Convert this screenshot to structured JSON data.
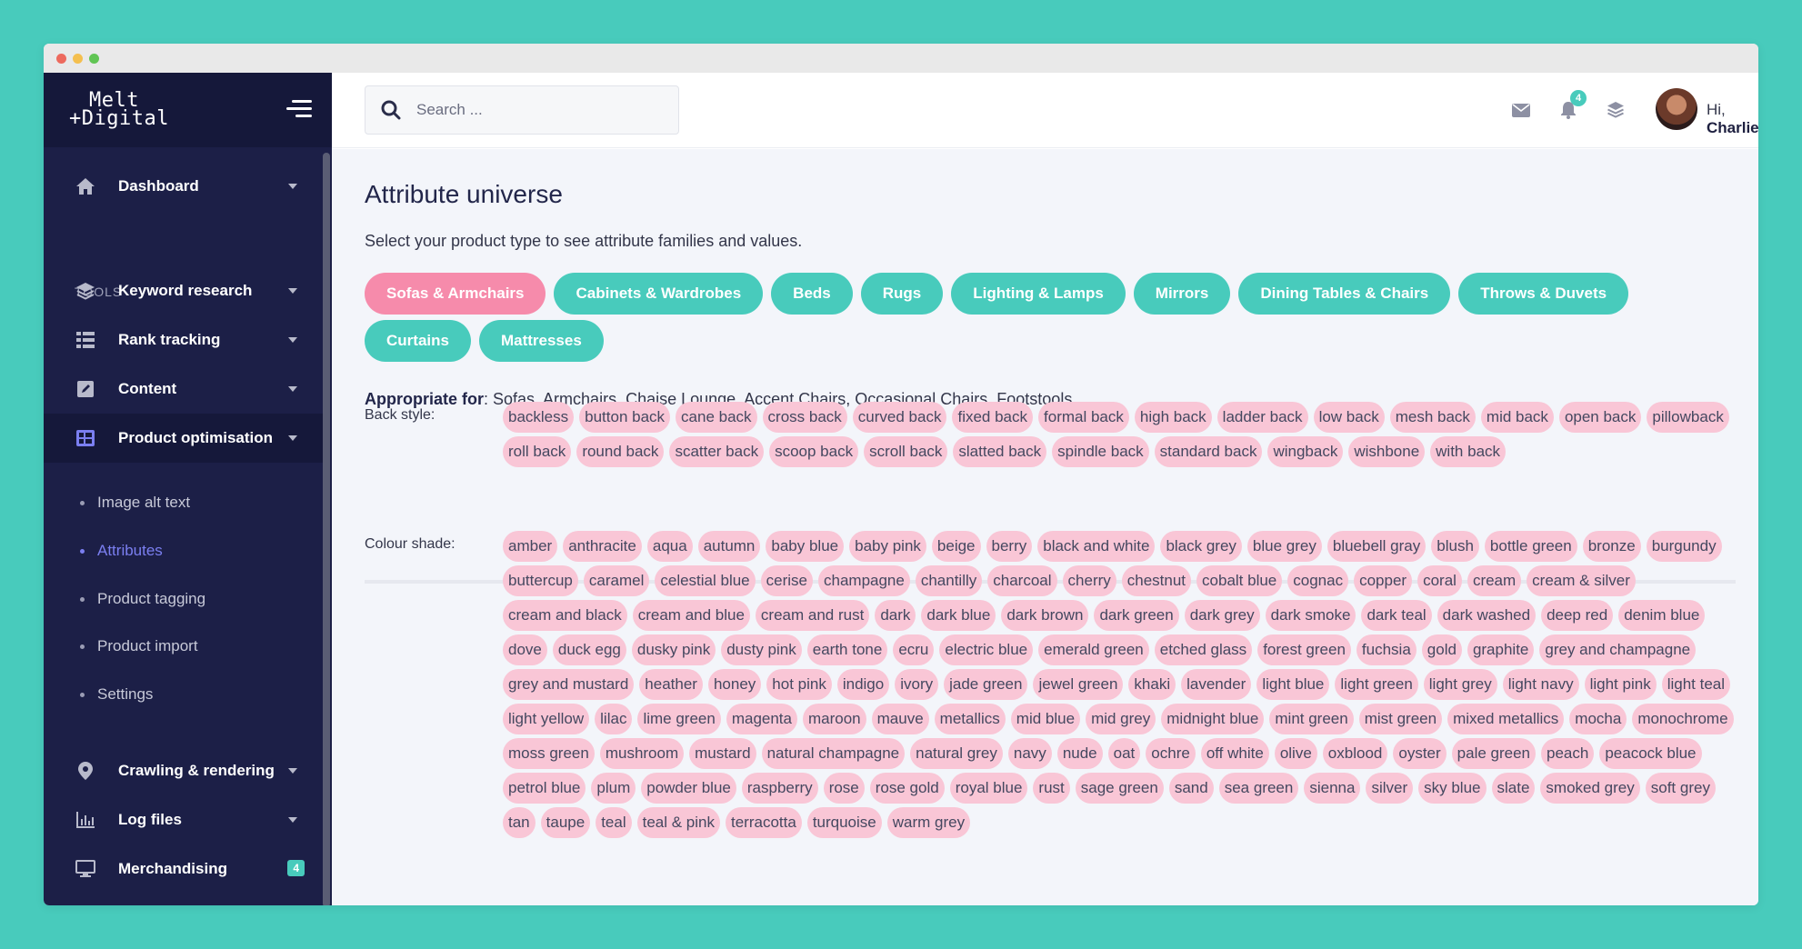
{
  "window": {
    "dots": [
      "#ed6a5e",
      "#f4bf4f",
      "#61c554"
    ]
  },
  "brand": {
    "line1": "Melt",
    "line2": "+Digital"
  },
  "sidebar": {
    "nav": [
      {
        "label": "Dashboard",
        "icon": "home-icon"
      },
      {
        "label": "Keyword research",
        "icon": "layers-icon"
      },
      {
        "label": "Rank tracking",
        "icon": "table-icon"
      },
      {
        "label": "Content",
        "icon": "edit-icon"
      },
      {
        "label": "Product optimisation",
        "icon": "grid-icon"
      },
      {
        "label": "Crawling & rendering",
        "icon": "map-pin-icon"
      },
      {
        "label": "Log files",
        "icon": "bar-chart-icon"
      },
      {
        "label": "Merchandising",
        "icon": "monitor-icon",
        "badge": "4"
      }
    ],
    "section_label": "TOOLS",
    "sub_items": [
      "Image alt text",
      "Attributes",
      "Product tagging",
      "Product import",
      "Settings"
    ]
  },
  "topbar": {
    "search_placeholder": "Search ...",
    "notification_count": "4",
    "greeting_prefix": "Hi,",
    "user_name": "Charlie"
  },
  "main": {
    "title": "Attribute universe",
    "subtitle": "Select your product type to see attribute families and values.",
    "product_types": [
      "Sofas & Armchairs",
      "Cabinets & Wardrobes",
      "Beds",
      "Rugs",
      "Lighting & Lamps",
      "Mirrors",
      "Dining Tables & Chairs",
      "Throws & Duvets",
      "Curtains",
      "Mattresses"
    ],
    "selected_type": "Sofas & Armchairs",
    "appropriate_label": "Appropriate for",
    "appropriate_value": ": Sofas, Armchairs, Chaise Lounge, Accent Chairs, Occasional Chairs, Footstools",
    "attributes": [
      {
        "label": "Back style:",
        "values": [
          "backless",
          "button back",
          "cane back",
          "cross back",
          "curved back",
          "fixed back",
          "formal back",
          "high back",
          "ladder back",
          "low back",
          "mesh back",
          "mid back",
          "open back",
          "pillowback",
          "roll back",
          "round back",
          "scatter back",
          "scoop back",
          "scroll back",
          "slatted back",
          "spindle back",
          "standard back",
          "wingback",
          "wishbone",
          "with back"
        ]
      },
      {
        "label": "Colour shade:",
        "values": [
          "amber",
          "anthracite",
          "aqua",
          "autumn",
          "baby blue",
          "baby pink",
          "beige",
          "berry",
          "black and white",
          "black grey",
          "blue grey",
          "bluebell gray",
          "blush",
          "bottle green",
          "bronze",
          "burgundy",
          "buttercup",
          "caramel",
          "celestial blue",
          "cerise",
          "champagne",
          "chantilly",
          "charcoal",
          "cherry",
          "chestnut",
          "cobalt blue",
          "cognac",
          "copper",
          "coral",
          "cream",
          "cream & silver",
          "cream and black",
          "cream and blue",
          "cream and rust",
          "dark",
          "dark blue",
          "dark brown",
          "dark green",
          "dark grey",
          "dark smoke",
          "dark teal",
          "dark washed",
          "deep red",
          "denim blue",
          "dove",
          "duck egg",
          "dusky pink",
          "dusty pink",
          "earth tone",
          "ecru",
          "electric blue",
          "emerald green",
          "etched glass",
          "forest green",
          "fuchsia",
          "gold",
          "graphite",
          "grey and champagne",
          "grey and mustard",
          "heather",
          "honey",
          "hot pink",
          "indigo",
          "ivory",
          "jade green",
          "jewel green",
          "khaki",
          "lavender",
          "light blue",
          "light green",
          "light grey",
          "light navy",
          "light pink",
          "light teal",
          "light yellow",
          "lilac",
          "lime green",
          "magenta",
          "maroon",
          "mauve",
          "metallics",
          "mid blue",
          "mid grey",
          "midnight blue",
          "mint green",
          "mist green",
          "mixed metallics",
          "mocha",
          "monochrome",
          "moss green",
          "mushroom",
          "mustard",
          "natural champagne",
          "natural grey",
          "navy",
          "nude",
          "oat",
          "ochre",
          "off white",
          "olive",
          "oxblood",
          "oyster",
          "pale green",
          "peach",
          "peacock blue",
          "petrol blue",
          "plum",
          "powder blue",
          "raspberry",
          "rose",
          "rose gold",
          "royal blue",
          "rust",
          "sage green",
          "sand",
          "sea green",
          "sienna",
          "silver",
          "sky blue",
          "slate",
          "smoked grey",
          "soft grey",
          "tan",
          "taupe",
          "teal",
          "teal & pink",
          "terracotta",
          "turquoise",
          "warm grey"
        ]
      }
    ]
  }
}
